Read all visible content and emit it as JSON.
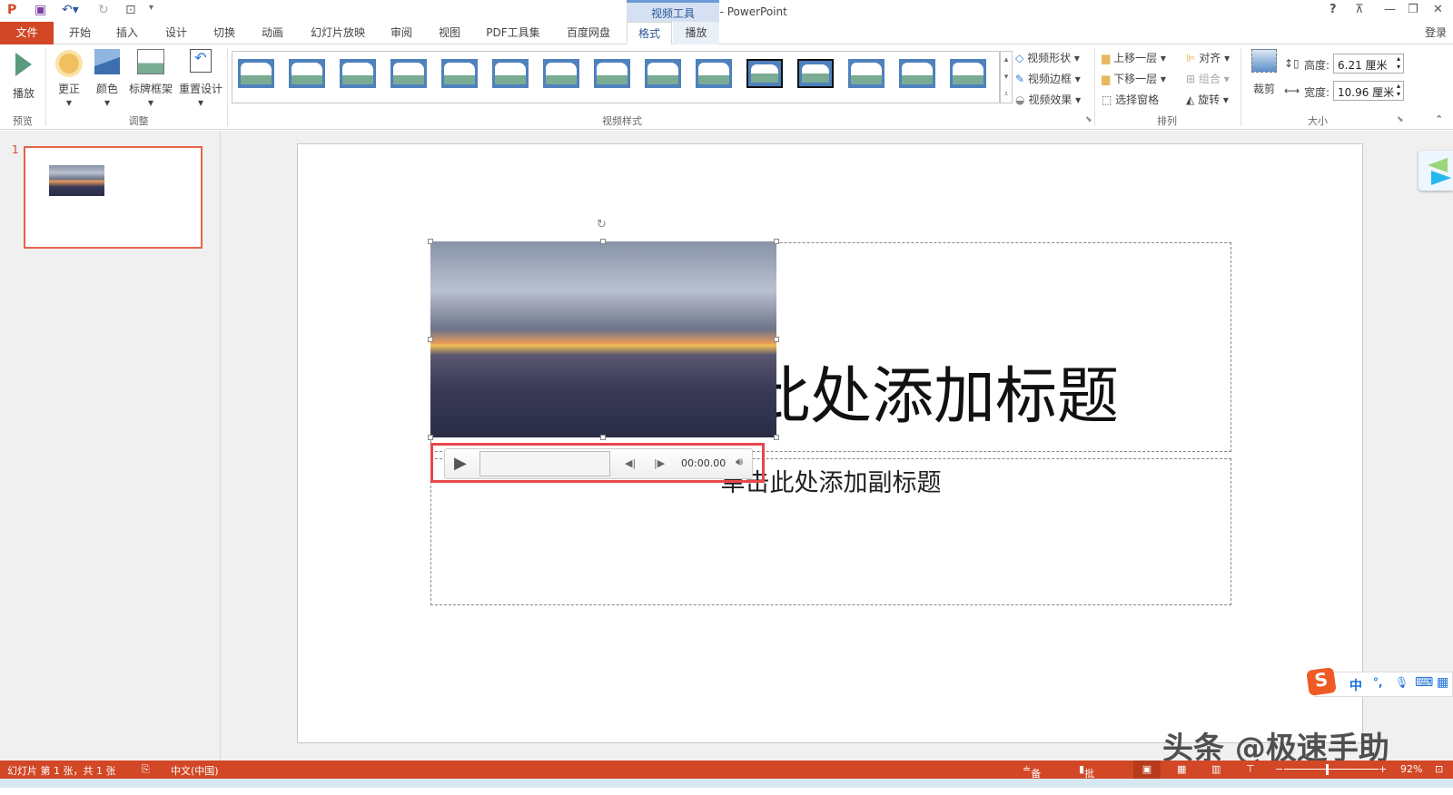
{
  "app": {
    "title": "演示文稿1 - PowerPoint",
    "context_tab": "视频工具",
    "login": "登录"
  },
  "tabs": [
    "文件",
    "开始",
    "插入",
    "设计",
    "切换",
    "动画",
    "幻灯片放映",
    "审阅",
    "视图",
    "PDF工具集",
    "百度网盘",
    "格式",
    "播放"
  ],
  "ribbon": {
    "preview": {
      "play": "播放",
      "group": "预览"
    },
    "adjust": {
      "items": [
        "更正",
        "颜色",
        "标牌框架",
        "重置设计"
      ],
      "group": "调整"
    },
    "styles": {
      "group": "视频样式",
      "count": 15
    },
    "style_opts": [
      "视频形状",
      "视频边框",
      "视频效果"
    ],
    "arrange": {
      "items": [
        "上移一层",
        "下移一层",
        "选择窗格",
        "对齐",
        "组合",
        "旋转"
      ],
      "group": "排列"
    },
    "size": {
      "crop": "裁剪",
      "height_label": "高度:",
      "height_value": "6.21 厘米",
      "width_label": "宽度:",
      "width_value": "10.96 厘米",
      "group": "大小"
    }
  },
  "slides": {
    "number": "1"
  },
  "slide": {
    "title": "单击此处添加标题",
    "subtitle": "单击此处添加副标题"
  },
  "player": {
    "time": "00:00.00"
  },
  "status": {
    "slide_info": "幻灯片 第 1 张，共 1 张",
    "language": "中文(中国)",
    "notes": "备注",
    "comments": "批注",
    "zoom": "92%"
  },
  "ime": {
    "mode": "中",
    "punct": "°,"
  },
  "watermark": "头条 @极速手助"
}
